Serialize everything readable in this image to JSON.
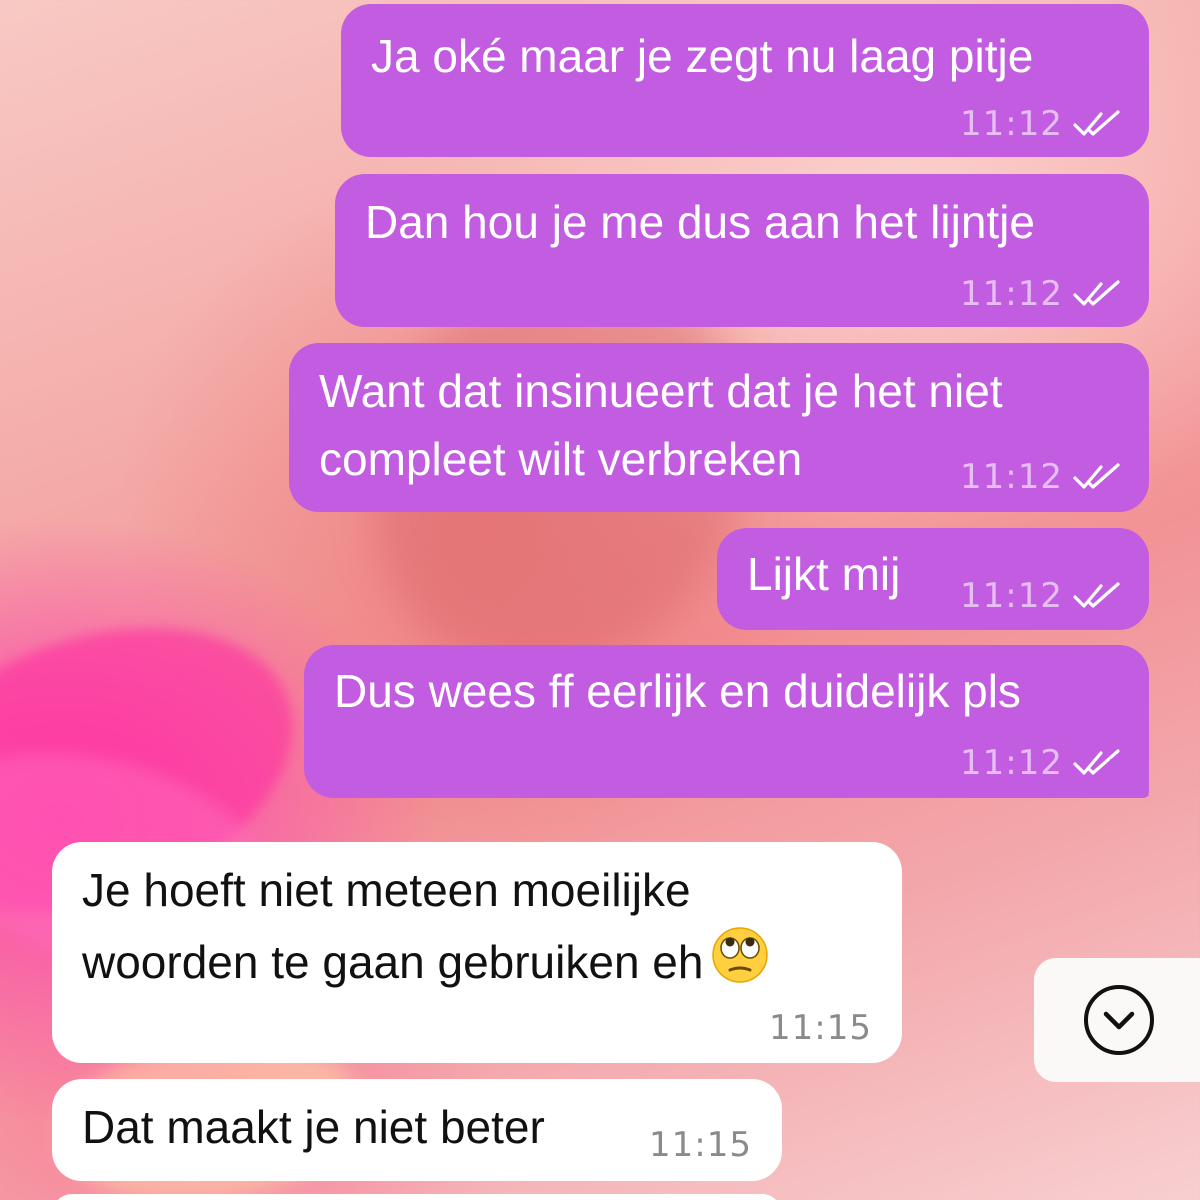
{
  "conversation": {
    "messages": [
      {
        "direction": "outgoing",
        "lines": [
          "Ja oké maar je zegt nu laag pitje"
        ],
        "time": "11:12",
        "status": "read"
      },
      {
        "direction": "outgoing",
        "lines": [
          "Dan hou je me dus aan het lijntje"
        ],
        "time": "11:12",
        "status": "read"
      },
      {
        "direction": "outgoing",
        "lines": [
          "Want dat insinueert dat je het niet",
          "compleet wilt verbreken"
        ],
        "time": "11:12",
        "status": "read"
      },
      {
        "direction": "outgoing",
        "lines": [
          "Lijkt mij"
        ],
        "time": "11:12",
        "status": "read"
      },
      {
        "direction": "outgoing",
        "lines": [
          "Dus wees ff eerlijk en duidelijk pls"
        ],
        "time": "11:12",
        "status": "read"
      },
      {
        "direction": "incoming",
        "lines": [
          "Je hoeft niet meteen moeilijke",
          "woorden te gaan gebruiken eh"
        ],
        "emoji": "face-with-rolling-eyes",
        "time": "11:15"
      },
      {
        "direction": "incoming",
        "lines": [
          "Dat maakt je niet beter"
        ],
        "time": "11:15"
      }
    ]
  },
  "scroll_button": {
    "icon": "chevron-down-circle-icon"
  },
  "colors": {
    "outgoing_bubble": "#c25ce0",
    "incoming_bubble": "#ffffff",
    "outgoing_text": "#ffffff",
    "incoming_text": "#111111"
  }
}
